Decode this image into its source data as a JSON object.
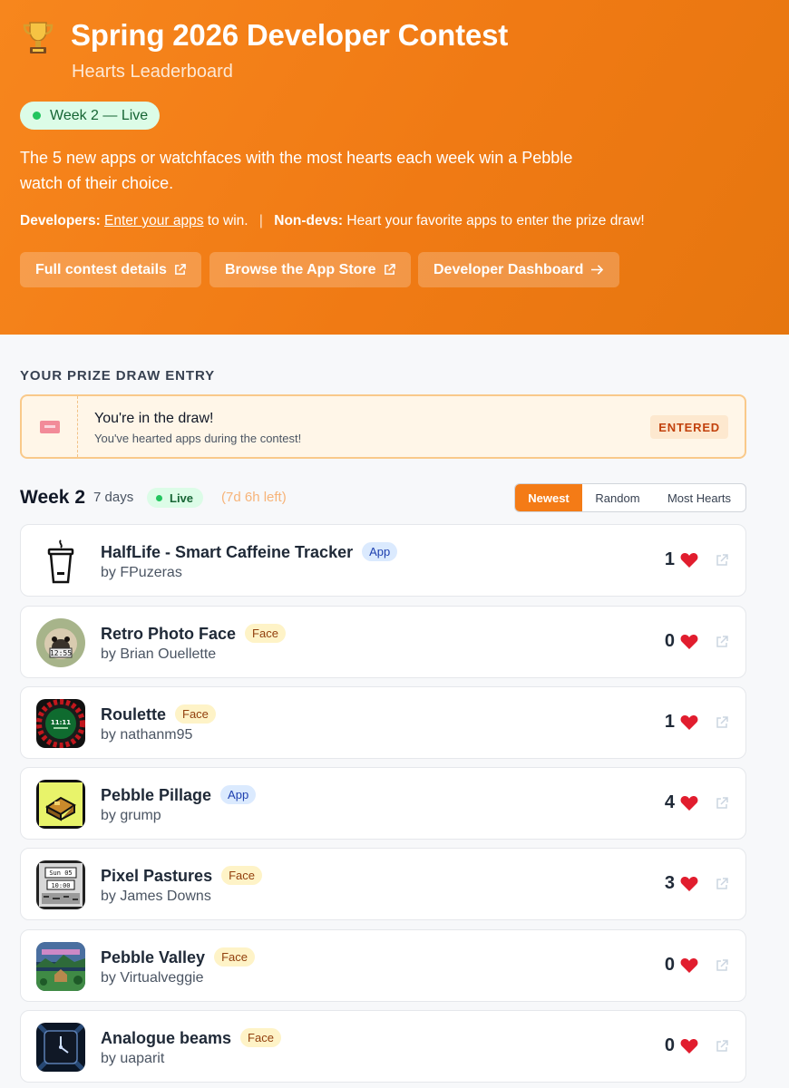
{
  "hero": {
    "title": "Spring 2026 Developer Contest",
    "subtitle": "Hearts Leaderboard",
    "status_pill": "Week 2 — Live",
    "description": "The 5 new apps or watchfaces with the most hearts each week win a Pebble watch of their choice.",
    "dev_label": "Developers:",
    "dev_link": "Enter your apps",
    "dev_suffix": "to win.",
    "separator": "|",
    "nondev_label": "Non-devs:",
    "nondev_text": "Heart your favorite apps to enter the prize draw!",
    "buttons": [
      {
        "label": "Full contest details",
        "icon": "external-link-icon"
      },
      {
        "label": "Browse the App Store",
        "icon": "external-link-icon"
      },
      {
        "label": "Developer Dashboard",
        "icon": "arrow-right-icon"
      }
    ],
    "colors": {
      "start": "#f7861d",
      "end": "#e6760f"
    }
  },
  "prize": {
    "heading": "YOUR PRIZE DRAW ENTRY",
    "title": "You're in the draw!",
    "text": "You've hearted apps during the contest!",
    "status": "ENTERED",
    "icon": "ticket-icon"
  },
  "week": {
    "title": "Week 2",
    "days": "7 days",
    "live": "Live",
    "time_left": "(7d 6h left)",
    "sort_options": [
      "Newest",
      "Random",
      "Most Hearts"
    ],
    "active_sort": "Newest"
  },
  "entries": [
    {
      "name": "HalfLife - Smart Caffeine Tracker",
      "type": "App",
      "author": "by FPuzeras",
      "hearts": "1"
    },
    {
      "name": "Retro Photo Face",
      "type": "Face",
      "author": "by Brian Ouellette",
      "hearts": "0"
    },
    {
      "name": "Roulette",
      "type": "Face",
      "author": "by nathanm95",
      "hearts": "1"
    },
    {
      "name": "Pebble Pillage",
      "type": "App",
      "author": "by grump",
      "hearts": "4"
    },
    {
      "name": "Pixel Pastures",
      "type": "Face",
      "author": "by James Downs",
      "hearts": "3"
    },
    {
      "name": "Pebble Valley",
      "type": "Face",
      "author": "by Virtualveggie",
      "hearts": "0"
    },
    {
      "name": "Analogue beams",
      "type": "Face",
      "author": "by uaparit",
      "hearts": "0"
    }
  ],
  "thumb_text": {
    "retro_time": "12:55",
    "roulette_time": "11:11",
    "pixel_date": "Sun 05",
    "pixel_time": "10:00"
  }
}
